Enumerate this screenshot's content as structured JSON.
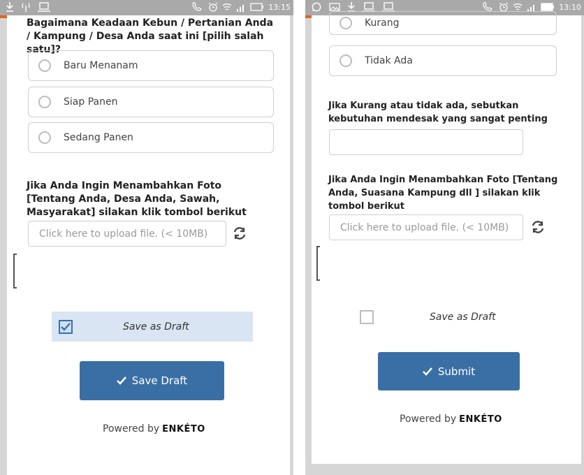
{
  "left": {
    "status": {
      "time": "13:15"
    },
    "question_top": "Bagaimana Keadaan Kebun / Pertanian Anda / Kampung / Desa Anda saat ini [pilih salah satu]?",
    "options": [
      "Baru Menanam",
      "Siap Panen",
      "Sedang Panen"
    ],
    "photo_question": "Jika Anda Ingin Menambahkan Foto [Tentang Anda, Desa Anda, Sawah, Masyarakat] silakan klik tombol berikut",
    "upload_placeholder": "Click here to upload file. (< 10MB)",
    "draft_label": "Save as Draft",
    "draft_checked": true,
    "button_label": "Save Draft",
    "powered_by": "Powered by",
    "brand": "ENKÉTO"
  },
  "right": {
    "status": {
      "time": "13:10"
    },
    "options": [
      "Kurang",
      "Tidak Ada"
    ],
    "need_question": "Jika Kurang atau tidak ada, sebutkan kebutuhan mendesak yang sangat penting",
    "photo_question": "Jika Anda Ingin Menambahkan Foto [Tentang Anda, Suasana Kampung dll ] silakan klik tombol berikut",
    "upload_placeholder": "Click here to upload file. (< 10MB)",
    "draft_label": "Save as Draft",
    "draft_checked": false,
    "button_label": "Submit",
    "powered_by": "Powered by",
    "brand": "ENKÉTO"
  },
  "icons": {
    "download": "download-icon",
    "antenna": "antenna-icon",
    "laptop": "laptop-icon",
    "whatsapp": "whatsapp-icon",
    "image": "image-icon",
    "call": "call-icon",
    "alarm": "alarm-icon",
    "wifi": "wifi-icon",
    "signal": "signal-icon",
    "battery": "battery-icon",
    "refresh": "refresh-icon",
    "check": "check-icon"
  },
  "colors": {
    "accent": "#3a6fa6",
    "status_bar": "#a9a9a9",
    "orange": "#e0661f",
    "draft_bg": "#d9e5f2"
  }
}
